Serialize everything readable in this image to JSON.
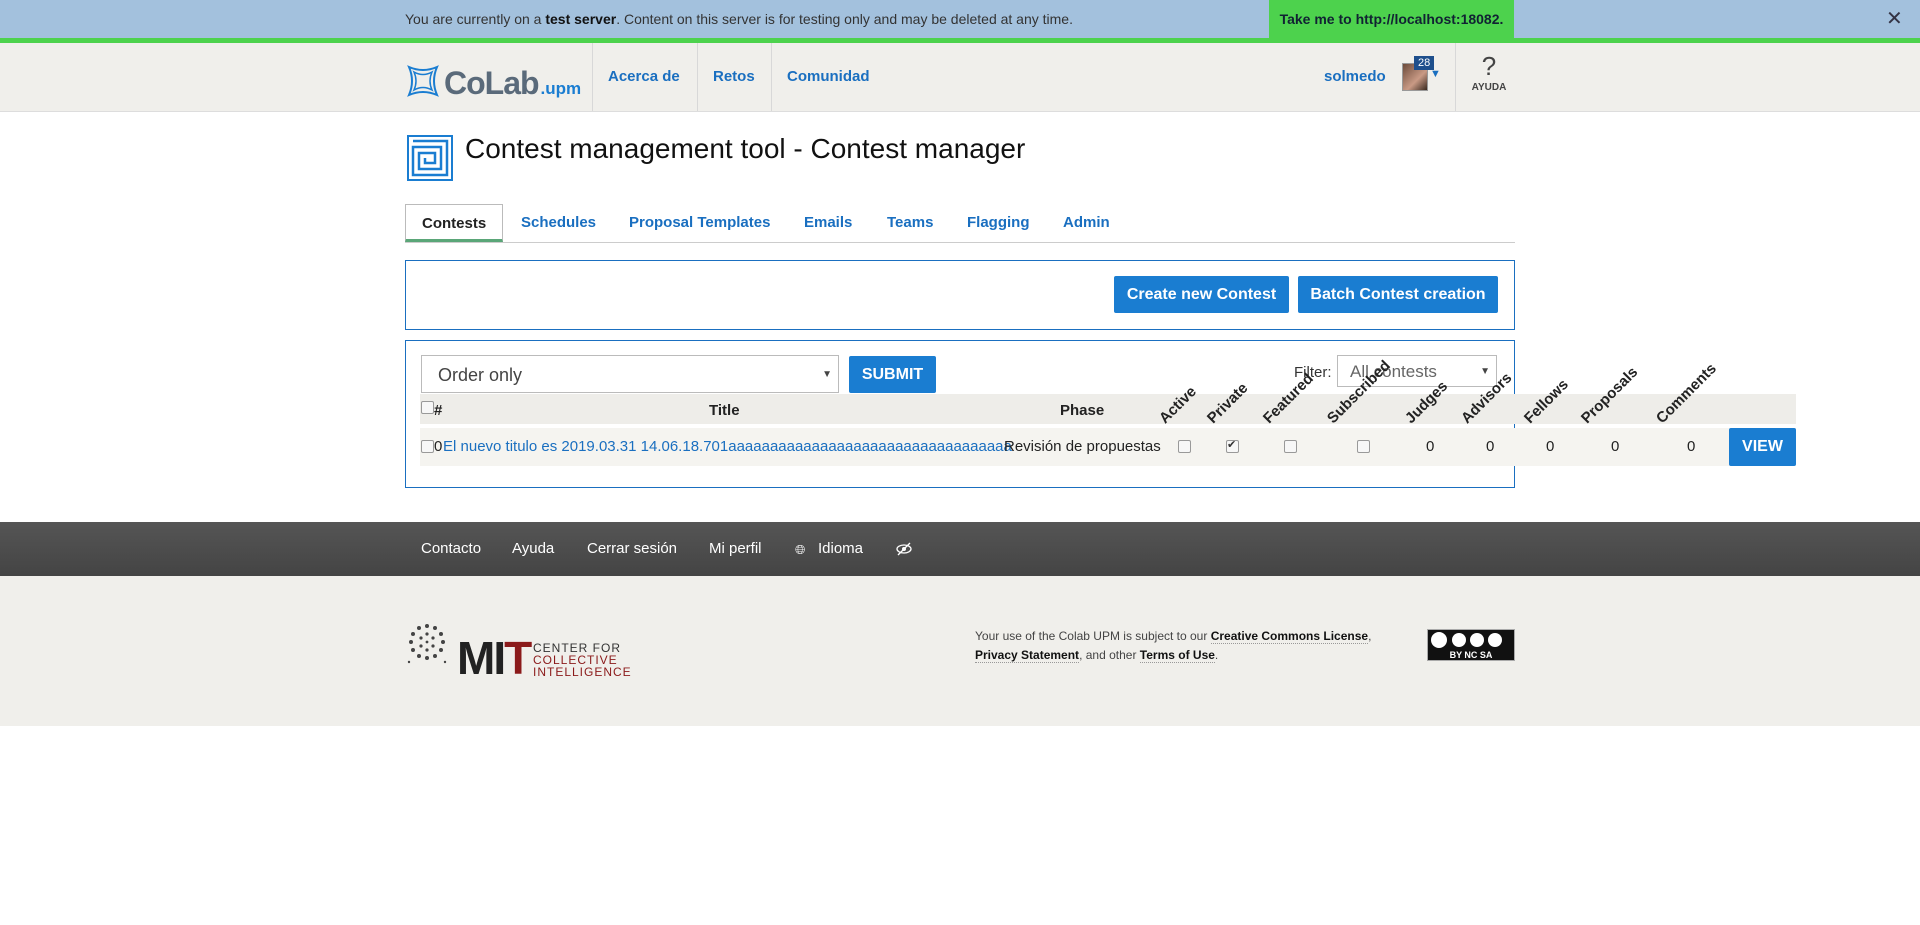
{
  "banner": {
    "prefix": "You are currently on a ",
    "strong": "test server",
    "suffix": ". Content on this server is for testing only and may be deleted at any time.",
    "link": "Take me to http://localhost:18082.",
    "close": "✕"
  },
  "nav": {
    "logo_main": "CoLab",
    "logo_sub": ".upm",
    "links": [
      "Acerca de",
      "Retos",
      "Comunidad"
    ],
    "user": "solmedo",
    "badge": "28",
    "help_symbol": "?",
    "help_label": "AYUDA"
  },
  "page": {
    "title": "Contest management tool - Contest manager"
  },
  "tabs": [
    "Contests",
    "Schedules",
    "Proposal Templates",
    "Emails",
    "Teams",
    "Flagging",
    "Admin"
  ],
  "actions": {
    "create": "Create new Contest",
    "batch": "Batch Contest creation"
  },
  "controls": {
    "order_value": "Order only",
    "submit": "SUBMIT",
    "filter_label": "Filter:",
    "filter_value": "All contests"
  },
  "table": {
    "headers": {
      "num": "#",
      "title": "Title",
      "phase": "Phase",
      "active": "Active",
      "private": "Private",
      "featured": "Featured",
      "subscribed": "Subscribed",
      "judges": "Judges",
      "advisors": "Advisors",
      "fellows": "Fellows",
      "proposals": "Proposals",
      "comments": "Comments"
    },
    "rows": [
      {
        "num": "0",
        "title": "El nuevo titulo es 2019.03.31 14.06.18.701aaaaaaaaaaaaaaaaaaaaaaaaaaaaaaaaaa",
        "phase": "Revisión de propuestas",
        "active": false,
        "private": true,
        "featured": false,
        "subscribed": false,
        "judges": "0",
        "advisors": "0",
        "fellows": "0",
        "proposals": "0",
        "comments": "0",
        "view": "VIEW"
      }
    ]
  },
  "footer": {
    "links": [
      "Contacto",
      "Ayuda",
      "Cerrar sesión",
      "Mi perfil",
      "Idioma"
    ],
    "mit_line1": "CENTER FOR",
    "mit_line2": "COLLECTIVE",
    "mit_line3": "INTELLIGENCE",
    "legal_prefix": "Your use of the Colab UPM is subject to our ",
    "legal_cc": "Creative Commons License",
    "legal_sep": ",",
    "legal_privacy": "Privacy Statement",
    "legal_mid": ", and other ",
    "legal_terms": "Terms of Use",
    "legal_end": ".",
    "cc_badge": "BY  NC  SA"
  },
  "colors": {
    "banner_bg": "#a3c1dd",
    "banner_accent": "#4dd24d",
    "link_blue": "#1a6fc0",
    "button_blue": "#1a7dd1",
    "footer_dark": "#4a4a4a"
  }
}
